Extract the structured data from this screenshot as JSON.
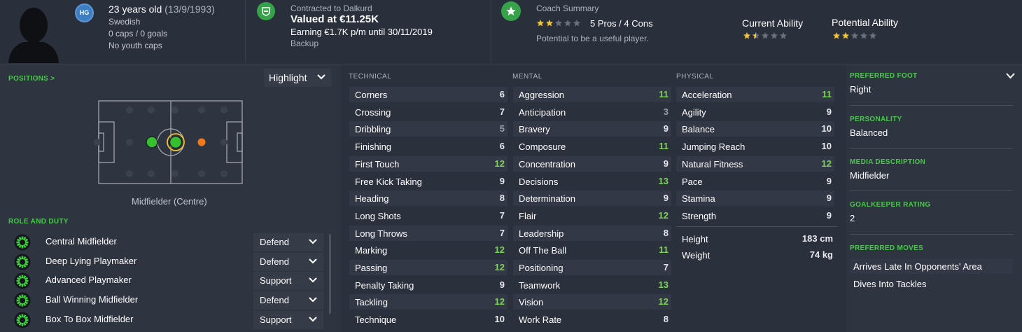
{
  "header": {
    "hg_badge": "HG",
    "age_text": "23 years old",
    "dob": "(13/9/1993)",
    "nationality": "Swedish",
    "caps": "0 caps / 0 goals",
    "youth_caps": "No youth caps",
    "contract_label": "Contracted to Dalkurd",
    "value": "Valued at €11.25K",
    "earning": "Earning €1.7K p/m until 30/11/2019",
    "squad_status": "Backup",
    "coach_summary_label": "Coach Summary",
    "pros_cons": "5 Pros / 4 Cons",
    "potential_text": "Potential to be a useful player.",
    "coach_stars": 2,
    "current_ability_label": "Current Ability",
    "current_ability_stars": 1.5,
    "potential_ability_label": "Potential Ability",
    "potential_ability_stars": 2
  },
  "positions": {
    "title": "POSITIONS >",
    "highlight_label": "Highlight",
    "position_label": "Midfielder (Centre)"
  },
  "roles": {
    "title": "ROLE AND DUTY",
    "items": [
      {
        "name": "Central Midfielder",
        "duty": "Defend"
      },
      {
        "name": "Deep Lying Playmaker",
        "duty": "Defend"
      },
      {
        "name": "Advanced Playmaker",
        "duty": "Support"
      },
      {
        "name": "Ball Winning Midfielder",
        "duty": "Defend"
      },
      {
        "name": "Box To Box Midfielder",
        "duty": "Support"
      }
    ]
  },
  "technical": {
    "title": "TECHNICAL",
    "items": [
      {
        "name": "Corners",
        "value": "6"
      },
      {
        "name": "Crossing",
        "value": "7"
      },
      {
        "name": "Dribbling",
        "value": "5"
      },
      {
        "name": "Finishing",
        "value": "6"
      },
      {
        "name": "First Touch",
        "value": "12"
      },
      {
        "name": "Free Kick Taking",
        "value": "9"
      },
      {
        "name": "Heading",
        "value": "8"
      },
      {
        "name": "Long Shots",
        "value": "7"
      },
      {
        "name": "Long Throws",
        "value": "7"
      },
      {
        "name": "Marking",
        "value": "12"
      },
      {
        "name": "Passing",
        "value": "12"
      },
      {
        "name": "Penalty Taking",
        "value": "9"
      },
      {
        "name": "Tackling",
        "value": "12"
      },
      {
        "name": "Technique",
        "value": "10"
      }
    ]
  },
  "mental": {
    "title": "MENTAL",
    "items": [
      {
        "name": "Aggression",
        "value": "11"
      },
      {
        "name": "Anticipation",
        "value": "3"
      },
      {
        "name": "Bravery",
        "value": "9"
      },
      {
        "name": "Composure",
        "value": "11"
      },
      {
        "name": "Concentration",
        "value": "9"
      },
      {
        "name": "Decisions",
        "value": "13"
      },
      {
        "name": "Determination",
        "value": "9"
      },
      {
        "name": "Flair",
        "value": "12"
      },
      {
        "name": "Leadership",
        "value": "8"
      },
      {
        "name": "Off The Ball",
        "value": "11"
      },
      {
        "name": "Positioning",
        "value": "7"
      },
      {
        "name": "Teamwork",
        "value": "13"
      },
      {
        "name": "Vision",
        "value": "12"
      },
      {
        "name": "Work Rate",
        "value": "8"
      }
    ]
  },
  "physical": {
    "title": "PHYSICAL",
    "items": [
      {
        "name": "Acceleration",
        "value": "11"
      },
      {
        "name": "Agility",
        "value": "9"
      },
      {
        "name": "Balance",
        "value": "10"
      },
      {
        "name": "Jumping Reach",
        "value": "10"
      },
      {
        "name": "Natural Fitness",
        "value": "12"
      },
      {
        "name": "Pace",
        "value": "9"
      },
      {
        "name": "Stamina",
        "value": "9"
      },
      {
        "name": "Strength",
        "value": "9"
      }
    ],
    "height_label": "Height",
    "height_value": "183 cm",
    "weight_label": "Weight",
    "weight_value": "74 kg"
  },
  "info": {
    "preferred_foot_label": "PREFERRED FOOT",
    "preferred_foot": "Right",
    "personality_label": "PERSONALITY",
    "personality": "Balanced",
    "media_label": "MEDIA DESCRIPTION",
    "media": "Midfielder",
    "gk_label": "GOALKEEPER RATING",
    "gk_rating": "2",
    "moves_label": "PREFERRED MOVES",
    "moves": [
      "Arrives Late In Opponents' Area",
      "Dives Into Tackles"
    ]
  },
  "colors": {
    "accent_green": "#48c84a",
    "highlight_value": "#7fd45a",
    "dim_value": "#9aa0aa",
    "star_gold": "#f2c12e",
    "star_empty": "#6b717b"
  }
}
